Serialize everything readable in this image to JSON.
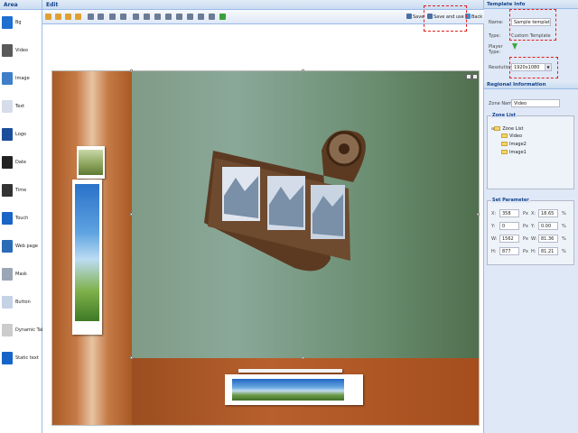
{
  "area": {
    "title": "Area",
    "items": [
      {
        "label": "Bg",
        "icon": "background-icon",
        "color": "#1e6fd0"
      },
      {
        "label": "Video",
        "icon": "film-icon",
        "color": "#5a5a5a"
      },
      {
        "label": "Image",
        "icon": "image-icon",
        "color": "#3f7fc9"
      },
      {
        "label": "Text",
        "icon": "text-icon",
        "color": "#d6dde8"
      },
      {
        "label": "Logo",
        "icon": "logo-icon",
        "color": "#1a4d9b"
      },
      {
        "label": "Date",
        "icon": "calendar-icon",
        "color": "#222222"
      },
      {
        "label": "Time",
        "icon": "clock-icon",
        "color": "#333333"
      },
      {
        "label": "Touch",
        "icon": "touch-icon",
        "color": "#1a64c6"
      },
      {
        "label": "Web page",
        "icon": "globe-icon",
        "color": "#2c6bb6"
      },
      {
        "label": "Mask",
        "icon": "mask-icon",
        "color": "#9aa6b5"
      },
      {
        "label": "Button",
        "icon": "button-icon",
        "color": "#c4d3e6"
      },
      {
        "label": "Dynamic Table",
        "icon": "table-icon",
        "color": "#cccccc"
      },
      {
        "label": "Static text",
        "icon": "static-text-icon",
        "color": "#1565c8"
      }
    ]
  },
  "edit": {
    "title": "Edit",
    "save_label": "Save",
    "save_and_use_label": "Save and use",
    "back_label": "Back"
  },
  "template_info": {
    "title": "Template Info",
    "name_label": "Name:",
    "name_value": "Sample template",
    "type_label": "Type:",
    "type_value": "Custom Template",
    "player_type_label": "Player Type:",
    "resolution_label": "Resolution:",
    "resolution_value": "1920x1080"
  },
  "regional_info": {
    "title": "Regional Information",
    "zone_name_label": "Zone Name:",
    "zone_name_value": "Video",
    "zone_list_title": "Zone List",
    "tree": {
      "root": "Zone List",
      "children": [
        "Video",
        "Image2",
        "Image1"
      ]
    }
  },
  "set_parameter": {
    "title": "Set Parameter",
    "rows": [
      {
        "a_label": "X:",
        "a_value": "358",
        "a_unit": "Px",
        "b_label": "X:",
        "b_value": "18.65",
        "b_unit": "%"
      },
      {
        "a_label": "Y:",
        "a_value": "0",
        "a_unit": "Px",
        "b_label": "Y:",
        "b_value": "0.00",
        "b_unit": "%"
      },
      {
        "a_label": "W:",
        "a_value": "1562",
        "a_unit": "Px",
        "b_label": "W:",
        "b_value": "81.36",
        "b_unit": "%"
      },
      {
        "a_label": "H:",
        "a_value": "877",
        "a_unit": "Px",
        "b_label": "H:",
        "b_value": "81.21",
        "b_unit": "%"
      }
    ]
  }
}
